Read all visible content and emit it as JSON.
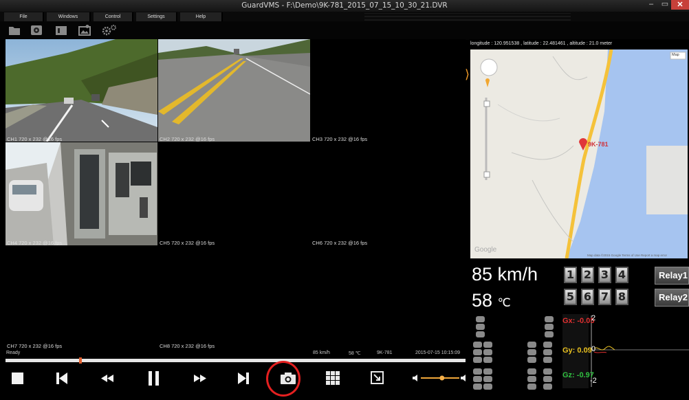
{
  "window": {
    "title": "GuardVMS - F:\\Demo\\9K-781_2015_07_15_10_30_21.DVR",
    "minimize": "–",
    "maximize": "▭",
    "close": "✕"
  },
  "menu": [
    "File",
    "Windows",
    "Control",
    "Settings",
    "Help"
  ],
  "toolbar": {
    "icons": [
      "folder-icon",
      "disk-search-icon",
      "camera-folder-icon",
      "image-map-icon",
      "settings-gears-icon"
    ]
  },
  "channels": [
    {
      "id": "CH1",
      "label": "CH1 720 x 232 @16 fps",
      "has_video": true
    },
    {
      "id": "CH2",
      "label": "CH2 720 x 232 @16 fps",
      "has_video": true
    },
    {
      "id": "CH3",
      "label": "CH3 720 x 232 @16 fps",
      "has_video": false
    },
    {
      "id": "CH4",
      "label": "CH4 720 x 232 @16 fps",
      "has_video": true
    },
    {
      "id": "CH5",
      "label": "CH5 720 x 232 @16 fps",
      "has_video": false
    },
    {
      "id": "CH6",
      "label": "CH6 720 x 232 @16 fps",
      "has_video": false
    },
    {
      "id": "CH7",
      "label": "CH7 720 x 232 @16 fps",
      "has_video": false
    },
    {
      "id": "CH8",
      "label": "CH8 720 x 232 @16 fps",
      "has_video": false
    }
  ],
  "status": {
    "state": "Ready",
    "speed": "85 km/h",
    "temp": "58 ℃",
    "plate": "9K-781",
    "datetime": "2015-07-15 10:15:09"
  },
  "playback": {
    "progress": 0.16,
    "volume": 0.55,
    "buttons": [
      "stop-icon",
      "skip-back-icon",
      "rewind-icon",
      "pause-icon",
      "fast-forward-icon",
      "skip-forward-icon",
      "snapshot-camera-icon",
      "grid-layout-icon",
      "screen-capture-icon"
    ]
  },
  "map": {
    "coords": "longitude : 120.951538 , latitude : 22.481461 , altitude : 21.0 meter",
    "type_label": "Map",
    "vehicle_label": "9K-781",
    "footer": "Map data ©2015 Google   Terms of Use   Report a map error",
    "brand": "Google"
  },
  "gauges": {
    "speed": "85 km/h",
    "temp_value": "58",
    "temp_unit": "℃",
    "channel_buttons": [
      "1",
      "2",
      "3",
      "4",
      "5",
      "6",
      "7",
      "8"
    ],
    "relays": [
      "Relay1",
      "Relay2"
    ]
  },
  "gsensor": {
    "gx": "Gx: -0.05",
    "gy": "Gy: 0.09",
    "gz": "Gz: -0.97",
    "scale_top": "2",
    "scale_mid": "0",
    "scale_bottom": "-2"
  },
  "colors": {
    "accent_record": "#e42020",
    "timeline_marker": "#e06030",
    "gx": "#e03030",
    "gy": "#e8c020",
    "gz": "#30c040",
    "map_sea": "#a6c4f0",
    "map_road": "#f5c23a"
  }
}
